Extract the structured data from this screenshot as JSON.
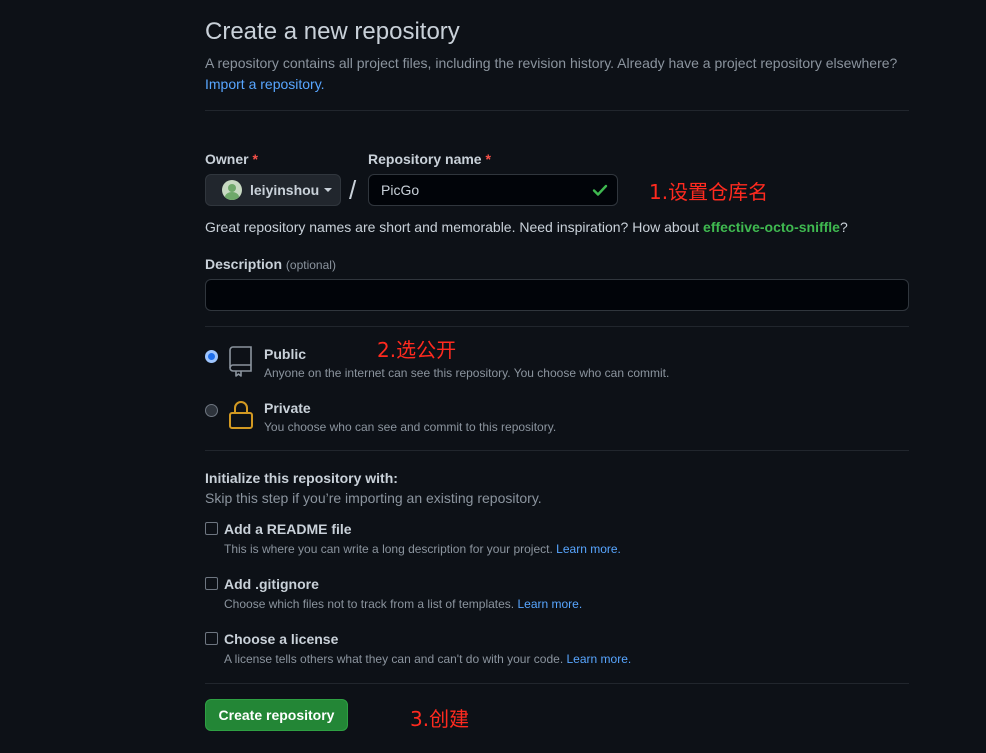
{
  "header": {
    "title": "Create a new repository",
    "subtitle": "A repository contains all project files, including the revision history. Already have a project repository elsewhere?",
    "import_link": "Import a repository."
  },
  "owner": {
    "label": "Owner",
    "required_mark": "*",
    "value": "leiyinshou"
  },
  "separator": "/",
  "repo_name": {
    "label": "Repository name",
    "required_mark": "*",
    "value": "PicGo"
  },
  "hint": {
    "text": "Great repository names are short and memorable. Need inspiration? How about ",
    "suggestion": "effective-octo-sniffle",
    "end": "?"
  },
  "description": {
    "label": "Description",
    "optional": "(optional)",
    "value": ""
  },
  "visibility": {
    "public": {
      "title": "Public",
      "desc": "Anyone on the internet can see this repository. You choose who can commit.",
      "selected": true
    },
    "private": {
      "title": "Private",
      "desc": "You choose who can see and commit to this repository.",
      "selected": false
    }
  },
  "init": {
    "title": "Initialize this repository with:",
    "subtitle": "Skip this step if you’re importing an existing repository.",
    "readme": {
      "title": "Add a README file",
      "desc": "This is where you can write a long description for your project.",
      "link": "Learn more."
    },
    "gitignore": {
      "title": "Add .gitignore",
      "desc": "Choose which files not to track from a list of templates.",
      "link": "Learn more."
    },
    "license": {
      "title": "Choose a license",
      "desc": "A license tells others what they can and can't do with your code.",
      "link": "Learn more."
    }
  },
  "create_button": "Create repository",
  "annotations": {
    "step1": "1.设置仓库名",
    "step2": "2.选公开",
    "step3": "3.创建"
  },
  "colors": {
    "background": "#0d1117",
    "accent": "#58a6ff",
    "success": "#3fb950",
    "button": "#238636",
    "annotation": "#ff2a1f"
  },
  "icons": {
    "public": "repo-icon",
    "private": "lock-icon",
    "valid": "check-icon"
  }
}
